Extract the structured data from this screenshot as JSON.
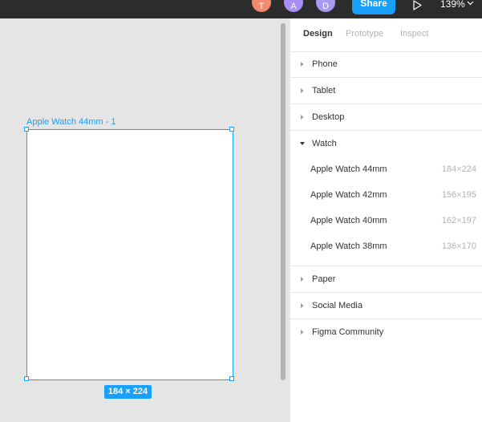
{
  "topbar": {
    "avatars": [
      {
        "initial": "T",
        "color": "#f24e1e"
      },
      {
        "initial": "A",
        "color": "#9747ff"
      },
      {
        "initial": "D",
        "color": "#7b61ff"
      }
    ],
    "share_label": "Share",
    "zoom_label": "139%",
    "icons": [
      "play-icon",
      "chevron-down-icon"
    ]
  },
  "canvas": {
    "frame_name": "Apple Watch 44mm - 1",
    "frame_size": "184 × 224"
  },
  "panel": {
    "tabs": [
      {
        "label": "Design",
        "active": true
      },
      {
        "label": "Prototype",
        "active": false
      },
      {
        "label": "Inspect",
        "active": false
      }
    ],
    "sections_before": [
      {
        "label": "Phone"
      },
      {
        "label": "Tablet"
      },
      {
        "label": "Desktop"
      }
    ],
    "expanded": {
      "label": "Watch",
      "presets": [
        {
          "name": "Apple Watch 44mm",
          "dims": "184×224"
        },
        {
          "name": "Apple Watch 42mm",
          "dims": "156×195"
        },
        {
          "name": "Apple Watch 40mm",
          "dims": "162×197"
        },
        {
          "name": "Apple Watch 38mm",
          "dims": "136×170"
        }
      ]
    },
    "sections_after": [
      {
        "label": "Paper"
      },
      {
        "label": "Social Media"
      },
      {
        "label": "Figma Community"
      }
    ]
  },
  "colors": {
    "accent": "#18a0fb",
    "toolbar": "#2c2c2c",
    "canvas": "#e5e5e5"
  }
}
